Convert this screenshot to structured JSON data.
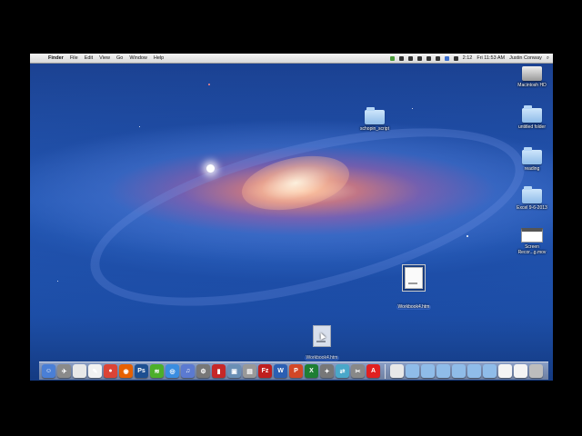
{
  "menubar": {
    "app_name": "Finder",
    "menus": [
      "File",
      "Edit",
      "View",
      "Go",
      "Window",
      "Help"
    ],
    "clock": "Fri 11:53 AM",
    "user": "Justin Conway",
    "status_text": "2:12"
  },
  "desktop_icons": [
    {
      "label": "Macintosh HD",
      "kind": "disk"
    },
    {
      "label": "untitled folder",
      "kind": "folder"
    },
    {
      "label": "reading",
      "kind": "folder"
    },
    {
      "label": "Excel 9-6-2013",
      "kind": "folder"
    },
    {
      "label": "Screen Recor...g.mov",
      "kind": "screenshot"
    },
    {
      "label": "schopin_script",
      "kind": "folder"
    },
    {
      "label": "Workbook4.htm",
      "kind": "doc"
    },
    {
      "label": "Workbook4.htm",
      "kind": "doc-drag"
    }
  ],
  "dock": {
    "apps": [
      {
        "name": "finder-icon",
        "color": "#4a7fd6",
        "glyph": "☺"
      },
      {
        "name": "launchpad-icon",
        "color": "#8a8a8a",
        "glyph": "✈"
      },
      {
        "name": "textedit-icon",
        "color": "#e8e8e8",
        "glyph": ""
      },
      {
        "name": "pages-icon",
        "color": "#f2f2f2",
        "glyph": "✎"
      },
      {
        "name": "chrome-icon",
        "color": "#db4437",
        "glyph": "●"
      },
      {
        "name": "firefox-icon",
        "color": "#e66000",
        "glyph": "◉"
      },
      {
        "name": "photoshop-icon",
        "color": "#1d4f91",
        "glyph": "Ps"
      },
      {
        "name": "spotify-icon",
        "color": "#4caf2a",
        "glyph": "≋"
      },
      {
        "name": "safari-icon",
        "color": "#3a8de0",
        "glyph": "◎"
      },
      {
        "name": "itunes-icon",
        "color": "#5b7ad1",
        "glyph": "♫"
      },
      {
        "name": "system-preferences-icon",
        "color": "#777",
        "glyph": "⚙"
      },
      {
        "name": "flashcards-icon",
        "color": "#c62828",
        "glyph": "▮"
      },
      {
        "name": "iphoto-icon",
        "color": "#6a8fb5",
        "glyph": "▣"
      },
      {
        "name": "utility-icon",
        "color": "#999",
        "glyph": "▤"
      },
      {
        "name": "filezilla-icon",
        "color": "#bf1e1e",
        "glyph": "Fz"
      },
      {
        "name": "word-icon",
        "color": "#2b5fb3",
        "glyph": "W"
      },
      {
        "name": "powerpoint-icon",
        "color": "#d24726",
        "glyph": "P"
      },
      {
        "name": "excel-icon",
        "color": "#1e7e34",
        "glyph": "X"
      },
      {
        "name": "scripts-icon",
        "color": "#777",
        "glyph": "✦"
      },
      {
        "name": "migration-icon",
        "color": "#4aa7c9",
        "glyph": "⇄"
      },
      {
        "name": "tools-icon",
        "color": "#888",
        "glyph": "✂"
      },
      {
        "name": "acrobat-icon",
        "color": "#e02020",
        "glyph": "A"
      }
    ],
    "stacks": [
      {
        "name": "document-stack-icon",
        "color": "#e8e8e8"
      },
      {
        "name": "folder-stack-icon",
        "color": "#8fbce9"
      },
      {
        "name": "folder-stack-icon",
        "color": "#8fbce9"
      },
      {
        "name": "folder-stack-icon",
        "color": "#8fbce9"
      },
      {
        "name": "folder-stack-icon",
        "color": "#8fbce9"
      },
      {
        "name": "folder-stack-icon",
        "color": "#8fbce9"
      },
      {
        "name": "folder-stack-icon",
        "color": "#8fbce9"
      },
      {
        "name": "document-stack-icon",
        "color": "#f4f4f4"
      },
      {
        "name": "document-stack-icon",
        "color": "#f4f4f4"
      },
      {
        "name": "trash-icon",
        "color": "#bdbdbd"
      }
    ]
  }
}
